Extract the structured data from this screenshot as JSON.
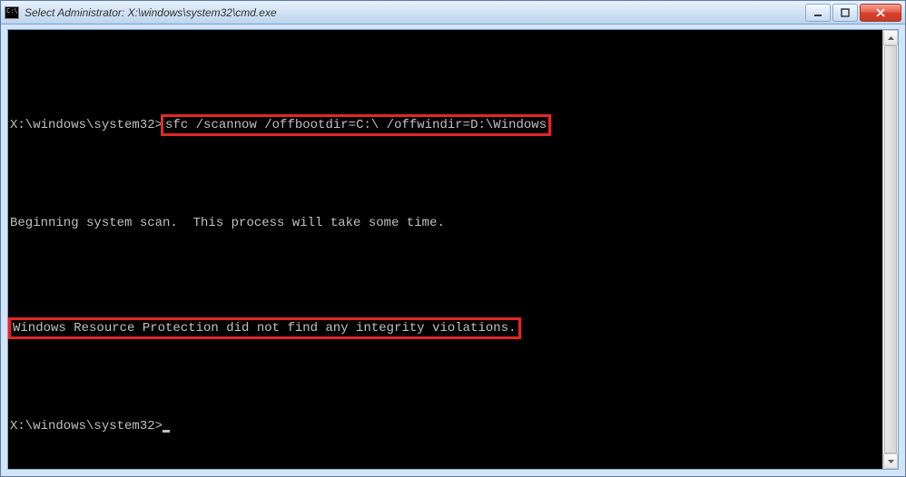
{
  "window": {
    "title": "Select Administrator: X:\\windows\\system32\\cmd.exe",
    "icon_text": "C:\\"
  },
  "console": {
    "prompt1": "X:\\windows\\system32>",
    "command": "sfc /scannow /offbootdir=C:\\ /offwindir=D:\\Windows",
    "line_scan": "Beginning system scan.  This process will take some time.",
    "line_result": "Windows Resource Protection did not find any integrity violations.",
    "prompt2": "X:\\windows\\system32>"
  }
}
